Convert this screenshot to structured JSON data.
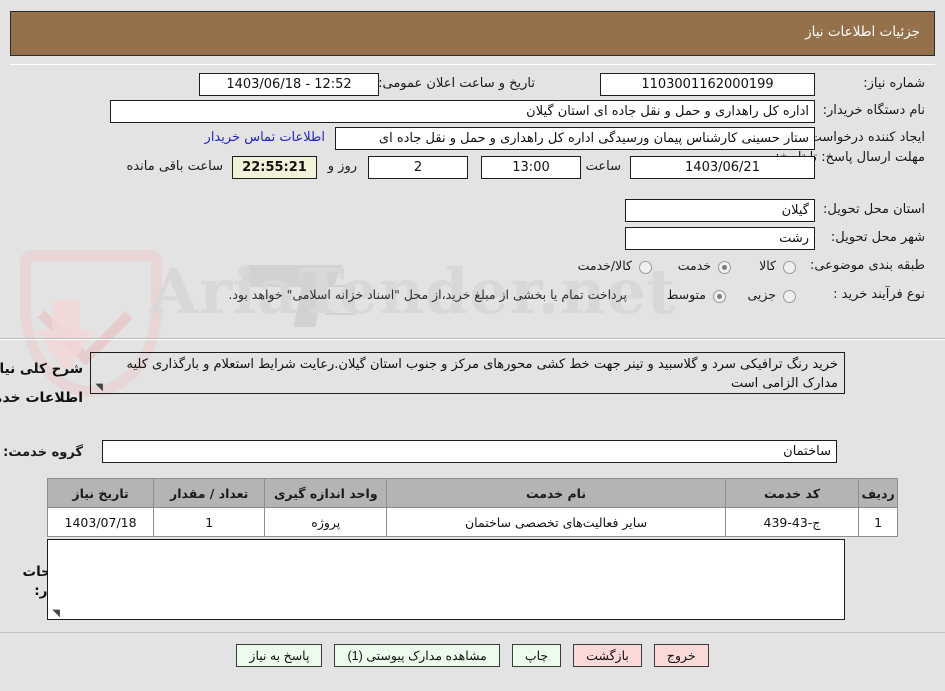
{
  "header": {
    "title": "جزئیات اطلاعات نیاز",
    "bar_color": "#94714a"
  },
  "form": {
    "need_number_label": "شماره نیاز:",
    "need_number_value": "1103001162000199",
    "announce_label": "تاریخ و ساعت اعلان عمومی:",
    "announce_value": "12:52 - 1403/06/18",
    "buyer_org_label": "نام دستگاه خریدار:",
    "buyer_org_value": "اداره کل راهداری و حمل و نقل جاده ای استان گیلان",
    "requester_label": "ایجاد کننده درخواست:",
    "requester_value": "ستار حسینی کارشناس پیمان ورسیدگی اداره کل راهداری و حمل و نقل جاده ای",
    "contact_link": "اطلاعات تماس خریدار",
    "deadline_label": "مهلت ارسال پاسخ: تا تاریخ:",
    "deadline_date": "1403/06/21",
    "hour_label": "ساعت",
    "deadline_time": "13:00",
    "remaining_days": "2",
    "days_and_label": "روز و",
    "remaining_time": "22:55:21",
    "remaining_suffix": "ساعت باقی مانده",
    "province_label": "استان محل تحویل:",
    "province_value": "گیلان",
    "city_label": "شهر محل تحویل:",
    "city_value": "رشت",
    "category_label": "طبقه بندی موضوعی:",
    "category_options": [
      {
        "label": "کالا",
        "selected": false
      },
      {
        "label": "خدمت",
        "selected": true
      },
      {
        "label": "کالا/خدمت",
        "selected": false
      }
    ],
    "process_label": "نوع فرآیند خرید :",
    "process_options": [
      {
        "label": "جزیی",
        "selected": false
      },
      {
        "label": "متوسط",
        "selected": true
      }
    ],
    "treasury_note": "پرداخت تمام یا بخشی از مبلغ خرید،از محل \"اسناد خزانه اسلامی\" خواهد بود."
  },
  "description": {
    "label": "شرح کلی نیاز:",
    "value": "خرید رنگ ترافیکی سرد و گلاسبید و تینر جهت خط کشی محورهای مرکز و جنوب استان گیلان.رعایت شرایط استعلام و بارگذاری کلیه مدارک الزامی است"
  },
  "services": {
    "section_title": "اطلاعات خدمات مورد نیاز",
    "group_label": "گروه خدمت:",
    "group_value": "ساختمان",
    "table": {
      "columns": [
        "ردیف",
        "کد خدمت",
        "نام خدمت",
        "واحد اندازه گیری",
        "تعداد / مقدار",
        "تاریخ نیاز"
      ],
      "rows": [
        {
          "index": "1",
          "service_code": "ج-43-439",
          "service_name": "سایر فعالیت‌های تخصصی ساختمان",
          "unit": "پروژه",
          "quantity": "1",
          "need_date": "1403/07/18"
        }
      ]
    }
  },
  "notes": {
    "label": "توضیحات خریدار:",
    "value": ""
  },
  "footer": {
    "buttons": [
      {
        "label": "پاسخ به نیاز",
        "style": "green"
      },
      {
        "label": "مشاهده مدارک پیوستی (1)",
        "style": "green"
      },
      {
        "label": "چاپ",
        "style": "green"
      },
      {
        "label": "بازگشت",
        "style": "pink"
      },
      {
        "label": "خروج",
        "style": "pink"
      }
    ]
  },
  "watermark": {
    "text": "AriaTender.net"
  }
}
